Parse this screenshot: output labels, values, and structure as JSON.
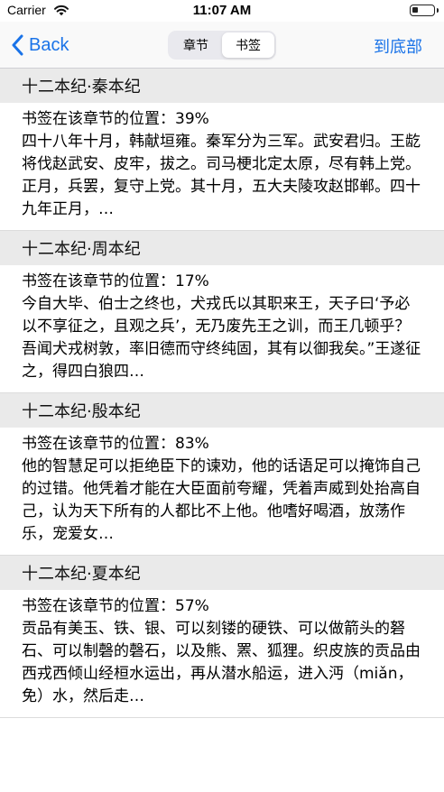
{
  "status_bar": {
    "carrier": "Carrier",
    "time": "11:07 AM"
  },
  "nav": {
    "back_label": "Back",
    "tabs": [
      {
        "label": "章节",
        "active": false
      },
      {
        "label": "书签",
        "active": true
      }
    ],
    "to_bottom_label": "到底部"
  },
  "colors": {
    "accent": "#1a73e8",
    "section_header_bg": "#eaeaea"
  },
  "bookmarks": [
    {
      "chapter": "十二本纪·秦本纪",
      "position": "书签在该章节的位置：39%",
      "excerpt": "四十八年十月，韩献垣雍。秦军分为三军。武安君归。王龁将伐赵武安、皮牢，拔之。司马梗北定太原，尽有韩上党。正月，兵罢，复守上党。其十月，五大夫陵攻赵邯郸。四十九年正月，…"
    },
    {
      "chapter": "十二本纪·周本纪",
      "position": "书签在该章节的位置：17%",
      "excerpt": "今自大毕、伯士之终也，犬戎氏以其职来王，天子曰‘予必以不享征之，且观之兵’，无乃废先王之训，而王几顿乎？吾闻犬戎树敦，率旧德而守终纯固，其有以御我矣。”王遂征之，得四白狼四…"
    },
    {
      "chapter": "十二本纪·殷本纪",
      "position": "书签在该章节的位置：83%",
      "excerpt": "他的智慧足可以拒绝臣下的谏劝，他的话语足可以掩饰自己的过错。他凭着才能在大臣面前夸耀，凭着声威到处抬高自己，认为天下所有的人都比不上他。他嗜好喝酒，放荡作乐，宠爱女…"
    },
    {
      "chapter": "十二本纪·夏本纪",
      "position": "书签在该章节的位置：57%",
      "excerpt": "贡品有美玉、铁、银、可以刻镂的硬铁、可以做箭头的砮石、可以制磬的磬石，以及熊、罴、狐狸。织皮族的贡品由西戎西倾山经桓水运出，再从潜水船运，进入沔（miǎn，免）水，然后走…"
    }
  ]
}
